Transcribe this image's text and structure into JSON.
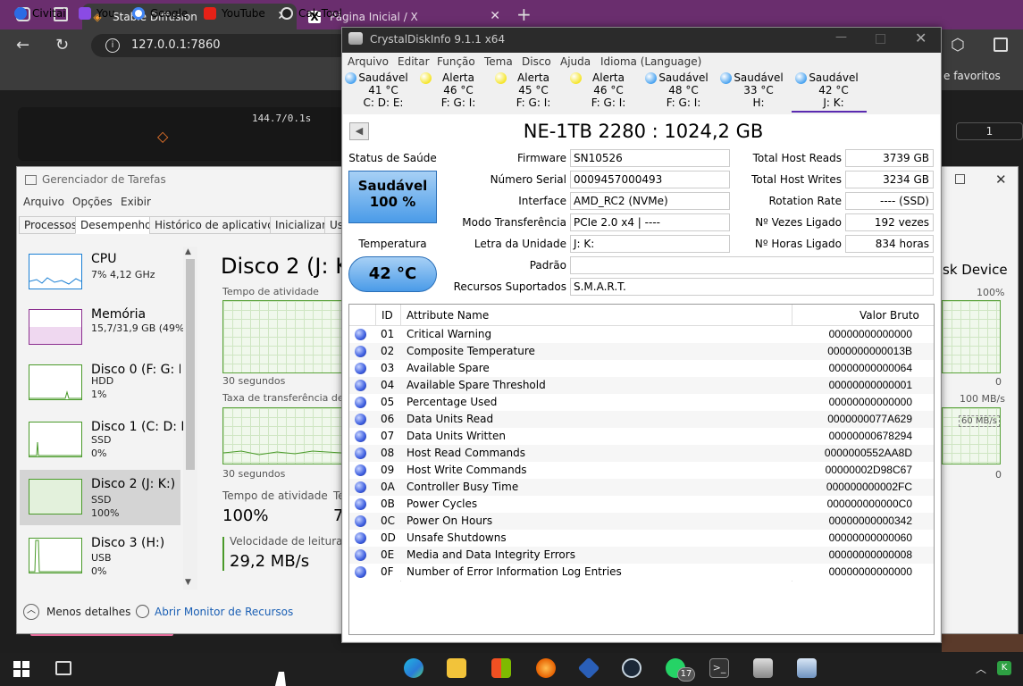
{
  "browser": {
    "tabs": [
      {
        "title": "Stable Diffusion"
      },
      {
        "title": "Página Inicial / X"
      }
    ],
    "url": "127.0.0.1:7860",
    "bookmarks": [
      "Civitai",
      "You",
      "Google",
      "YouTube",
      "CalcTool"
    ],
    "bookmarks_right": "e favoritos",
    "page_text": "144.7/0.1s",
    "page_number": "1"
  },
  "taskmgr": {
    "title": "Gerenciador de Tarefas",
    "menu": [
      "Arquivo",
      "Opções",
      "Exibir"
    ],
    "tabs": [
      "Processos",
      "Desempenho",
      "Histórico de aplicativos",
      "Inicializar",
      "Us"
    ],
    "sidebar": [
      {
        "name": "CPU",
        "sub1": "7% 4,12 GHz",
        "sub2": ""
      },
      {
        "name": "Memória",
        "sub1": "15,7/31,9 GB (49%)",
        "sub2": ""
      },
      {
        "name": "Disco 0 (F: G: I:)",
        "sub1": "HDD",
        "sub2": "1%"
      },
      {
        "name": "Disco 1 (C: D: E",
        "sub1": "SSD",
        "sub2": "0%"
      },
      {
        "name": "Disco 2 (J: K:)",
        "sub1": "SSD",
        "sub2": "100%"
      },
      {
        "name": "Disco 3 (H:)",
        "sub1": "USB",
        "sub2": "0%"
      }
    ],
    "main_title": "Disco 2 (J: K:",
    "device_suffix": "sk Device",
    "activity_label": "Tempo de atividade",
    "pct_100": "100%",
    "zero": "0",
    "seconds": "30 segundos",
    "transfer_label": "Taxa de transferência de d",
    "mbs_100": "100 MB/s",
    "mbs_60": "60 MB/s",
    "stat_activity_label": "Tempo de atividade",
    "stat_activity_value": "100%",
    "stat_t_label": "Te",
    "stat_t_value": "7",
    "read_label": "Velocidade de leitura",
    "read_value": "29,2 MB/s",
    "less_details": "Menos detalhes",
    "open_monitor": "Abrir Monitor de Recursos"
  },
  "cdi": {
    "title": "CrystalDiskInfo 9.1.1 x64",
    "menu": [
      "Arquivo",
      "Editar",
      "Função",
      "Tema",
      "Disco",
      "Ajuda",
      "Idioma (Language)"
    ],
    "disks": [
      {
        "status": "Saudável",
        "temp": "41 °C",
        "letters": "C: D: E:",
        "color": "#4aa3f0"
      },
      {
        "status": "Alerta",
        "temp": "46 °C",
        "letters": "F: G: I:",
        "color": "#f5e52a"
      },
      {
        "status": "Alerta",
        "temp": "45 °C",
        "letters": "F: G: I:",
        "color": "#f5e52a"
      },
      {
        "status": "Alerta",
        "temp": "46 °C",
        "letters": "F: G: I:",
        "color": "#f5e52a"
      },
      {
        "status": "Saudável",
        "temp": "48 °C",
        "letters": "F: G: I:",
        "color": "#4aa3f0"
      },
      {
        "status": "Saudável",
        "temp": "33 °C",
        "letters": "H:",
        "color": "#4aa3f0"
      },
      {
        "status": "Saudável",
        "temp": "42 °C",
        "letters": "J: K:",
        "color": "#4aa3f0"
      }
    ],
    "model": "NE-1TB 2280 : 1024,2 GB",
    "health_label": "Status de Saúde",
    "health_status": "Saudável",
    "health_pct": "100 %",
    "temp_label": "Temperatura",
    "temp_value": "42 °C",
    "fields_left": [
      {
        "label": "Firmware",
        "value": "SN10526"
      },
      {
        "label": "Número Serial",
        "value": "0009457000493"
      },
      {
        "label": "Interface",
        "value": "AMD_RC2 (NVMe)"
      },
      {
        "label": "Modo Transferência",
        "value": "PCIe 2.0 x4 | ----"
      },
      {
        "label": "Letra da Unidade",
        "value": "J: K:"
      }
    ],
    "fields_right": [
      {
        "label": "Total Host Reads",
        "value": "3739 GB"
      },
      {
        "label": "Total Host Writes",
        "value": "3234 GB"
      },
      {
        "label": "Rotation Rate",
        "value": "---- (SSD)"
      },
      {
        "label": "Nº Vezes Ligado",
        "value": "192 vezes"
      },
      {
        "label": "Nº Horas Ligado",
        "value": "834 horas"
      }
    ],
    "standard_label": "Padrão",
    "standard_value": "",
    "features_label": "Recursos Suportados",
    "features_value": "S.M.A.R.T.",
    "smart_headers": {
      "id": "ID",
      "name": "Attribute Name",
      "raw": "Valor Bruto"
    },
    "smart": [
      {
        "id": "01",
        "name": "Critical Warning",
        "raw": "00000000000000"
      },
      {
        "id": "02",
        "name": "Composite Temperature",
        "raw": "0000000000013B"
      },
      {
        "id": "03",
        "name": "Available Spare",
        "raw": "00000000000064"
      },
      {
        "id": "04",
        "name": "Available Spare Threshold",
        "raw": "00000000000001"
      },
      {
        "id": "05",
        "name": "Percentage Used",
        "raw": "00000000000000"
      },
      {
        "id": "06",
        "name": "Data Units Read",
        "raw": "0000000077A629"
      },
      {
        "id": "07",
        "name": "Data Units Written",
        "raw": "00000000678294"
      },
      {
        "id": "08",
        "name": "Host Read Commands",
        "raw": "0000000552AA8D"
      },
      {
        "id": "09",
        "name": "Host Write Commands",
        "raw": "00000002D98C67"
      },
      {
        "id": "0A",
        "name": "Controller Busy Time",
        "raw": "000000000002FC"
      },
      {
        "id": "0B",
        "name": "Power Cycles",
        "raw": "000000000000C0"
      },
      {
        "id": "0C",
        "name": "Power On Hours",
        "raw": "00000000000342"
      },
      {
        "id": "0D",
        "name": "Unsafe Shutdowns",
        "raw": "00000000000060"
      },
      {
        "id": "0E",
        "name": "Media and Data Integrity Errors",
        "raw": "00000000000008"
      },
      {
        "id": "0F",
        "name": "Number of Error Information Log Entries",
        "raw": "00000000000000"
      }
    ]
  },
  "taskbar": {
    "whatsapp_badge": "17"
  }
}
